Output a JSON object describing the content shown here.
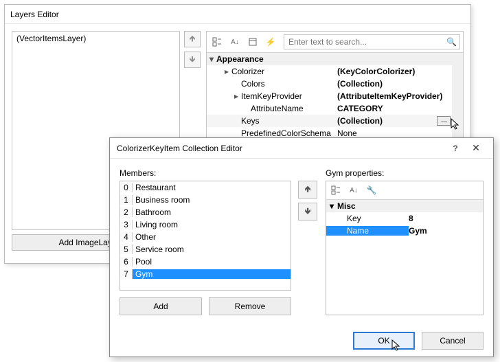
{
  "layers_editor": {
    "title": "Layers Editor",
    "list": [
      "(VectorItemsLayer)"
    ],
    "add_button": "Add ImageLayer",
    "search_placeholder": "Enter text to search...",
    "category": "Appearance",
    "rows": [
      {
        "indent": 1,
        "exp": "▸",
        "name": "Colorizer",
        "value": "(KeyColorColorizer)",
        "bold": true
      },
      {
        "indent": 2,
        "exp": "",
        "name": "Colors",
        "value": "(Collection)",
        "bold": true
      },
      {
        "indent": 2,
        "exp": "▸",
        "name": "ItemKeyProvider",
        "value": "(AttributeItemKeyProvider)",
        "bold": true
      },
      {
        "indent": 3,
        "exp": "",
        "name": "AttributeName",
        "value": "CATEGORY",
        "bold": true
      },
      {
        "indent": 2,
        "exp": "",
        "name": "Keys",
        "value": "(Collection)",
        "bold": true,
        "selected": true,
        "ellipsis": true
      },
      {
        "indent": 2,
        "exp": "",
        "name": "PredefinedColorSchema",
        "value": "None",
        "bold": false
      }
    ]
  },
  "dialog": {
    "title": "ColorizerKeyItem Collection Editor",
    "members_label": "Members:",
    "members": [
      "Restaurant",
      "Business room",
      "Bathroom",
      "Living room",
      "Other",
      "Service room",
      "Pool",
      "Gym"
    ],
    "selected_index": 7,
    "add": "Add",
    "remove": "Remove",
    "props_label": "Gym properties:",
    "misc": "Misc",
    "key_label": "Key",
    "key_value": "8",
    "name_label": "Name",
    "name_value": "Gym",
    "ok": "OK",
    "cancel": "Cancel"
  }
}
